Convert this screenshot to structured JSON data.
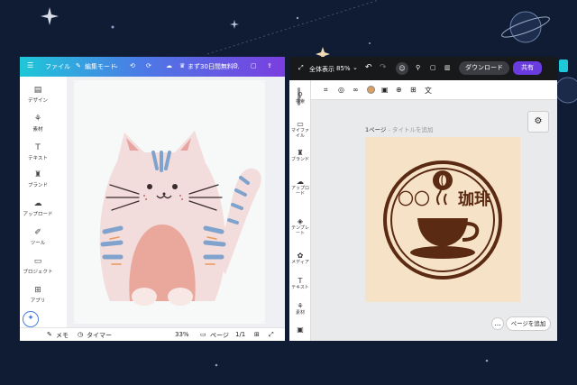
{
  "left_window": {
    "topbar": {
      "file_label": "ファイル",
      "mode_label": "編集モード",
      "trial_label": "まず30日間無料..."
    },
    "sidebar": [
      {
        "label": "デザイン",
        "icon": "layout-icon"
      },
      {
        "label": "素材",
        "icon": "shapes-icon"
      },
      {
        "label": "テキスト",
        "icon": "text-icon"
      },
      {
        "label": "ブランド",
        "icon": "brand-icon"
      },
      {
        "label": "アップロード",
        "icon": "upload-icon"
      },
      {
        "label": "ツール",
        "icon": "draw-icon"
      },
      {
        "label": "プロジェクト",
        "icon": "folder-icon"
      },
      {
        "label": "アプリ",
        "icon": "apps-icon"
      }
    ],
    "bottombar": {
      "notes_label": "メモ",
      "timer_label": "タイマー",
      "zoom": "33%",
      "page_label": "ページ",
      "page_count": "1/1"
    }
  },
  "right_window": {
    "topbar": {
      "fullscreen_label": "全体表示",
      "zoom": "85%",
      "download_label": "ダウンロード",
      "share_label": "共有"
    },
    "sidebar": [
      {
        "label": "検索",
        "icon": "search-icon"
      },
      {
        "label": "マイファイル",
        "icon": "folder-icon"
      },
      {
        "label": "ブランド",
        "icon": "brand-icon"
      },
      {
        "label": "アップロード",
        "icon": "upload-icon"
      },
      {
        "label": "テンプレート",
        "icon": "template-icon"
      },
      {
        "label": "メディア",
        "icon": "media-icon"
      },
      {
        "label": "テキスト",
        "icon": "text-icon"
      },
      {
        "label": "素材",
        "icon": "shapes-icon"
      }
    ],
    "page_title": "1ページ",
    "page_title_placeholder": "- タイトルを追加",
    "logo_text_left": "〇〇",
    "logo_text_right": "珈琲",
    "add_page_label": "ページを追加"
  },
  "colors": {
    "background": "#0f1c33",
    "accent_purple": "#6a3ce0",
    "coffee_brown": "#5a2a12",
    "cream": "#f6e2c6"
  }
}
